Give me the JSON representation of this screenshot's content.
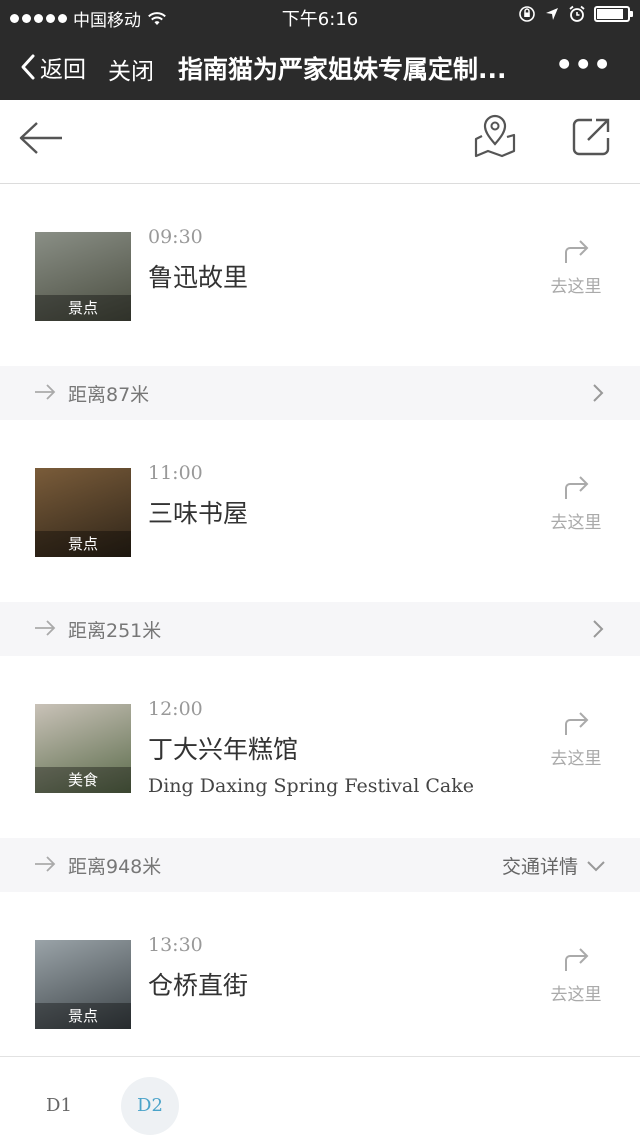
{
  "status_bar": {
    "carrier": "中国移动",
    "time": "下午6:16",
    "battery_level": 0.85
  },
  "nav": {
    "back_label": "返回",
    "close_label": "关闭",
    "title": "指南猫为严家姐妹专属定制...",
    "more_label": "•••"
  },
  "itinerary": {
    "stops": [
      {
        "time": "09:30",
        "name": "鲁迅故里",
        "en": "",
        "tag": "景点",
        "go_label": "去这里",
        "thumb_colors": [
          "#8a8f86",
          "#4a4d40"
        ]
      },
      {
        "time": "11:00",
        "name": "三味书屋",
        "en": "",
        "tag": "景点",
        "go_label": "去这里",
        "thumb_colors": [
          "#7a5c3a",
          "#2e2418"
        ]
      },
      {
        "time": "12:00",
        "name": "丁大兴年糕馆",
        "en": "Ding Daxing Spring Festival Cake",
        "tag": "美食",
        "go_label": "去这里",
        "thumb_colors": [
          "#c9c2b8",
          "#5a6b4a"
        ]
      },
      {
        "time": "13:30",
        "name": "仓桥直街",
        "en": "",
        "tag": "景点",
        "go_label": "去这里",
        "thumb_colors": [
          "#9aa3a8",
          "#3d4448"
        ]
      }
    ],
    "distances": [
      {
        "text": "距离87米",
        "detail": ""
      },
      {
        "text": "距离251米",
        "detail": ""
      },
      {
        "text": "距离948米",
        "detail": "交通详情"
      }
    ]
  },
  "day_bar": {
    "days": [
      "D1",
      "D2"
    ],
    "active_day": "D2"
  },
  "icons": {
    "toolbar": [
      "back-arrow-icon",
      "map-pin-icon",
      "share-icon"
    ],
    "go": "turn-right-arrow-icon"
  }
}
